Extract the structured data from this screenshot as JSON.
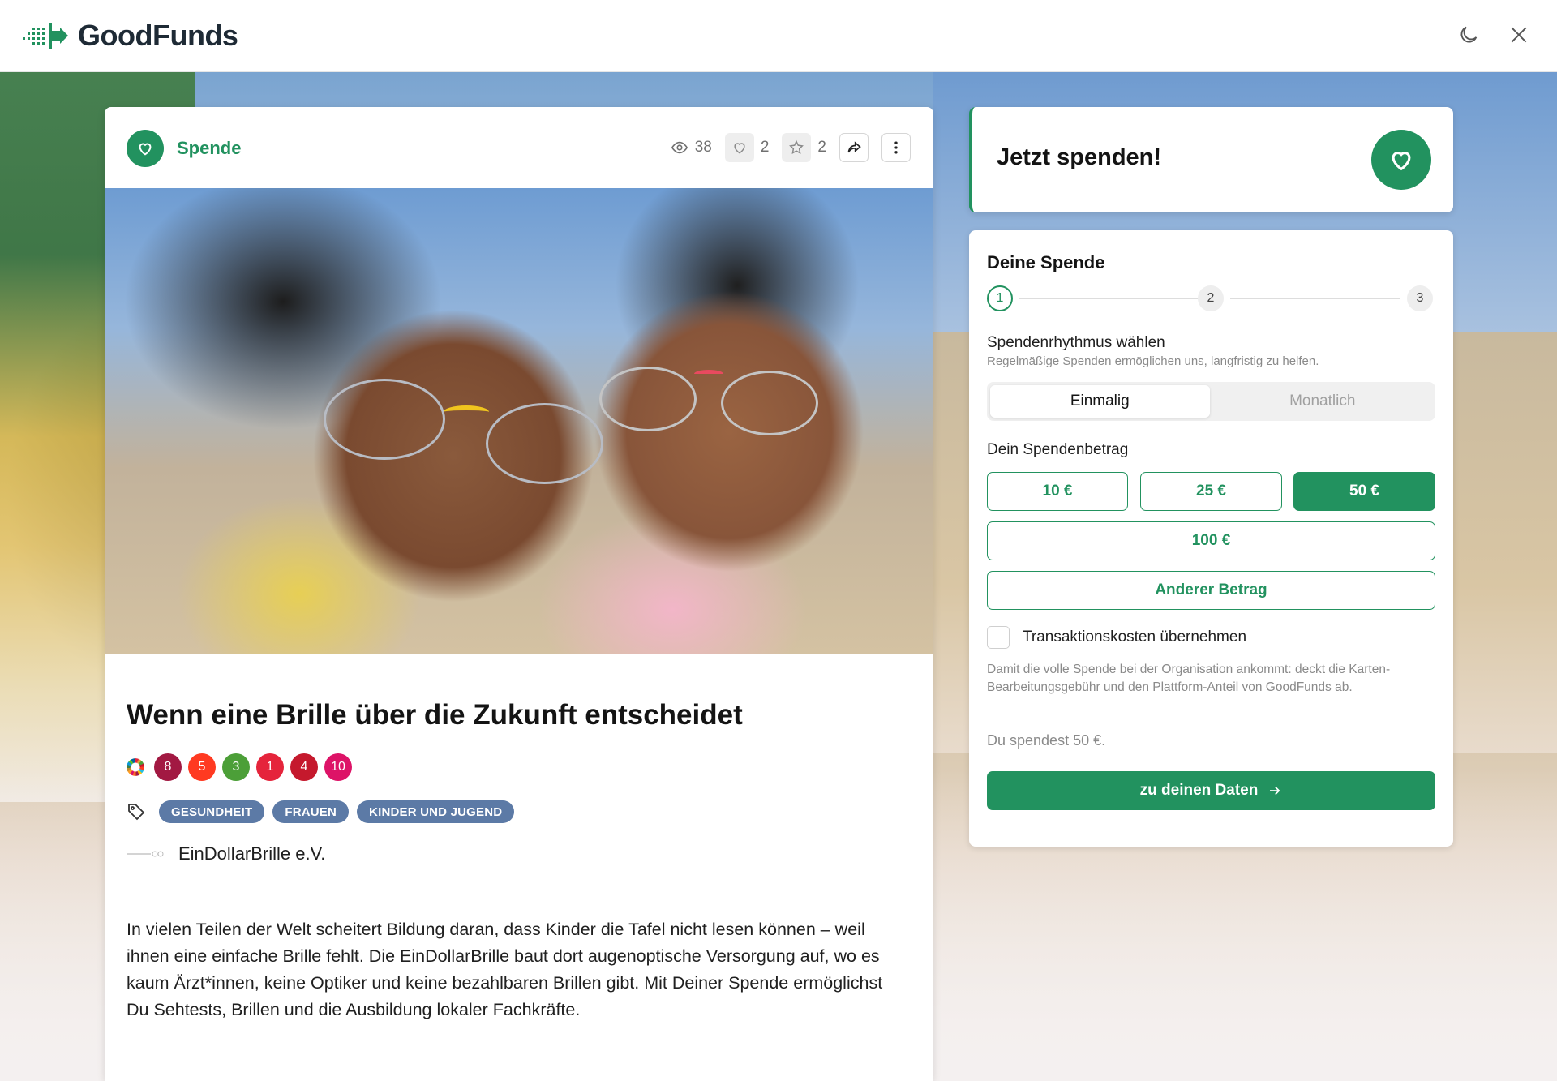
{
  "app": {
    "name": "GoodFunds"
  },
  "header": {
    "icons": [
      "moon-icon",
      "close-icon"
    ]
  },
  "card": {
    "type_label": "Spende",
    "stats": {
      "views": "38",
      "likes": "2",
      "favorites": "2"
    },
    "title": "Wenn eine Brille über die Zukunft entscheidet",
    "sdgs": [
      {
        "number": "8",
        "color": "#a21942"
      },
      {
        "number": "5",
        "color": "#ff3a21"
      },
      {
        "number": "3",
        "color": "#4c9f38"
      },
      {
        "number": "1",
        "color": "#e5243b"
      },
      {
        "number": "4",
        "color": "#c5192d"
      },
      {
        "number": "10",
        "color": "#dd1367"
      }
    ],
    "tags": [
      "GESUNDHEIT",
      "FRAUEN",
      "KINDER UND JUGEND"
    ],
    "organization": "EinDollarBrille e.V.",
    "description": "In vielen Teilen der Welt scheitert Bildung daran, dass Kinder die Tafel nicht lesen können – weil ihnen eine einfache Brille fehlt. Die EinDollarBrille baut dort augenoptische Versorgung auf, wo es kaum Ärzt*innen, keine Optiker und keine bezahlbaren Brillen gibt. Mit Deiner Spende ermöglichst Du Sehtests, Brillen und die Ausbildung lokaler Fachkräfte."
  },
  "cta": {
    "title": "Jetzt spenden!"
  },
  "donation": {
    "title": "Deine Spende",
    "steps": [
      "1",
      "2",
      "3"
    ],
    "active_step": 1,
    "rhythm_title": "Spendenrhythmus wählen",
    "rhythm_subtitle": "Regelmäßige Spenden ermöglichen uns, langfristig zu helfen.",
    "rhythm_options": [
      "Einmalig",
      "Monatlich"
    ],
    "rhythm_selected": "Einmalig",
    "amount_title": "Dein Spendenbetrag",
    "amounts": [
      "10 €",
      "25 €",
      "50 €",
      "100 €"
    ],
    "amount_selected": "50 €",
    "other_amount": "Anderer Betrag",
    "transaction_label": "Transaktionskosten übernehmen",
    "transaction_checked": false,
    "transaction_note": "Damit die volle Spende bei der Organisation ankommt: deckt die Karten-Bearbeitungsgebühr und den Plattform-Anteil von GoodFunds ab.",
    "summary": "Du spendest 50 €.",
    "next_button": "zu deinen Daten"
  },
  "colors": {
    "brand": "#22925f",
    "tag": "#5c7aa6"
  }
}
